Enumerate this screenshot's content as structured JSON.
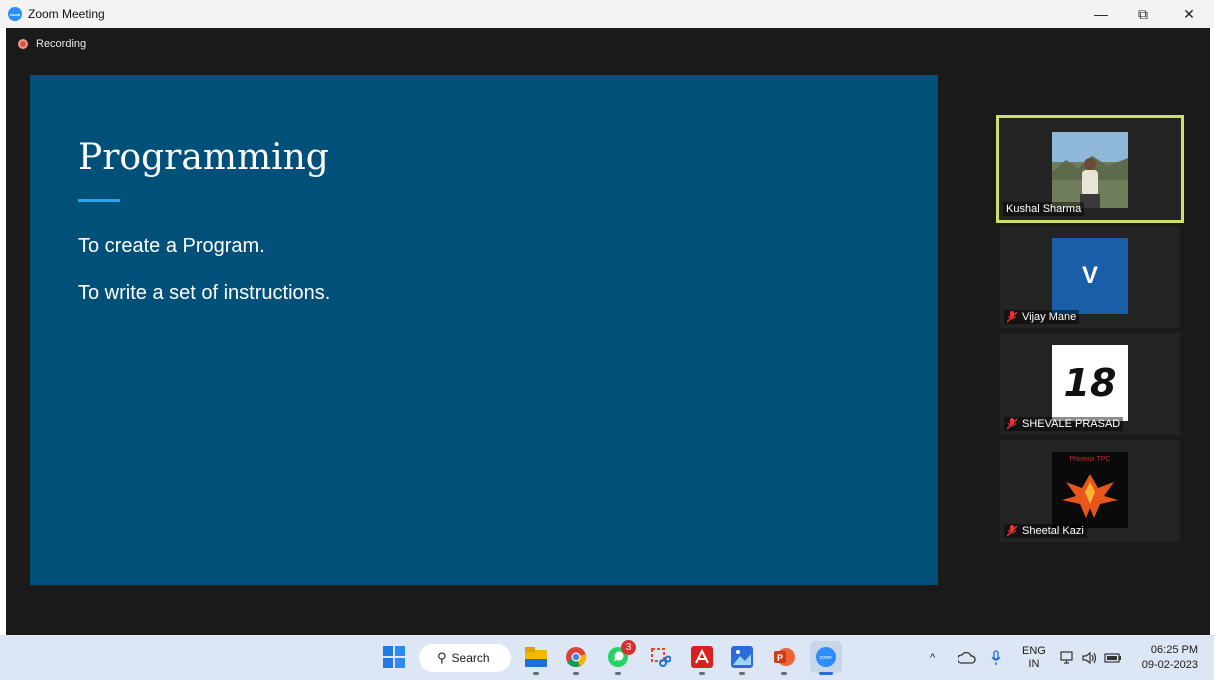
{
  "window": {
    "app_title": "Zoom Meeting",
    "logo_text": "zoom",
    "minimize": "—",
    "restore": "⧉",
    "close": "✕"
  },
  "meeting": {
    "recording_label": "Recording",
    "slide": {
      "title": "Programming",
      "lines": [
        "To create a Program.",
        "To write a set of instructions."
      ]
    },
    "participants": [
      {
        "name": "Kushal Sharma",
        "avatar": "photo",
        "muted": false,
        "active_speaker": true
      },
      {
        "name": "Vijay Mane",
        "avatar_letter": "V",
        "muted": true
      },
      {
        "name": "SHEVALE PRASAD",
        "avatar_text": "18",
        "muted": true
      },
      {
        "name": "Sheetal Kazi",
        "avatar_text": "Phoenix TPC",
        "muted": true
      }
    ]
  },
  "taskbar": {
    "search_label": "Search",
    "whatsapp_badge": "3",
    "apps": [
      "windows-start",
      "search",
      "file-explorer",
      "chrome",
      "whatsapp",
      "snipping-tool",
      "acrobat",
      "photos",
      "powerpoint",
      "zoom"
    ],
    "tray": {
      "lang_top": "ENG",
      "lang_bottom": "IN",
      "time": "06:25 PM",
      "date": "09-02-2023",
      "chevron": "^"
    }
  },
  "colors": {
    "slide_bg": "#00507a",
    "accent": "#22a7f0",
    "active_border": "#cde06c",
    "meeting_bg": "#1a1a1a"
  }
}
